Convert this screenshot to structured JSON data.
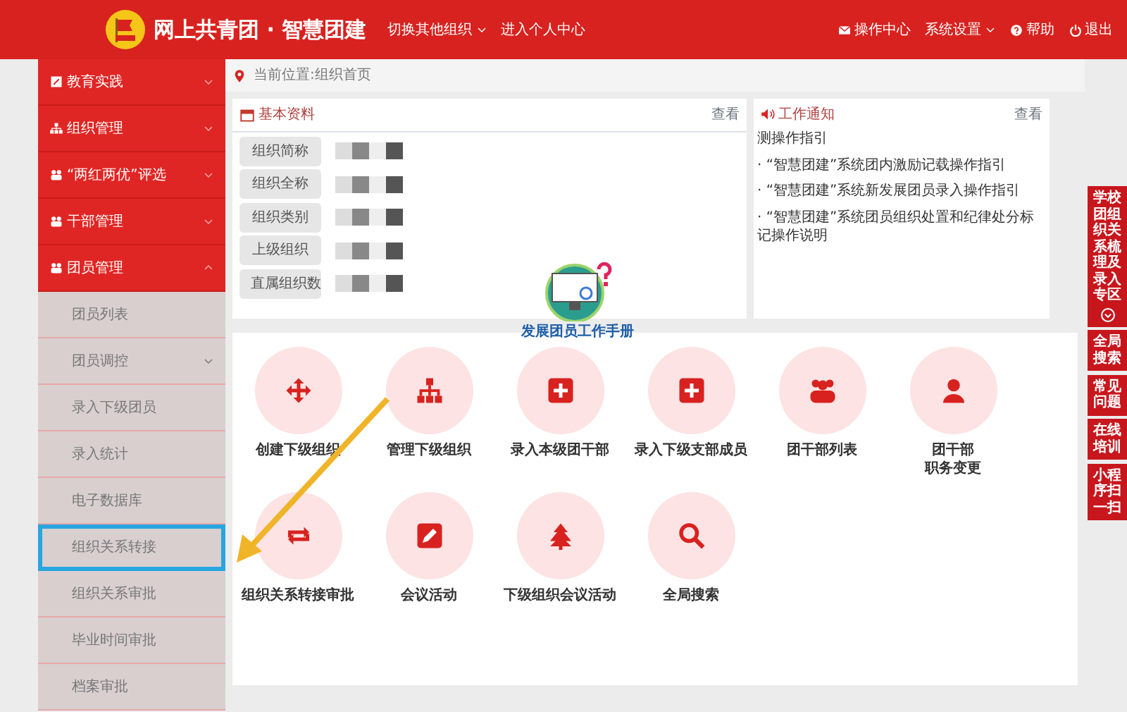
{
  "header": {
    "title": "网上共青团 · 智慧团建",
    "nav": [
      {
        "label": "切换其他组织",
        "dropdown": true
      },
      {
        "label": "进入个人中心",
        "dropdown": false
      }
    ],
    "actions": [
      {
        "label": "操作中心",
        "dropdown": false
      },
      {
        "label": "系统设置",
        "dropdown": true
      },
      {
        "label": "帮助",
        "dropdown": false
      },
      {
        "label": "退出",
        "dropdown": false
      }
    ]
  },
  "sidebar": {
    "items": [
      {
        "label": "教育实践",
        "expanded": false
      },
      {
        "label": "组织管理",
        "expanded": false
      },
      {
        "label": "“两红两优”评选",
        "expanded": false
      },
      {
        "label": "干部管理",
        "expanded": false
      },
      {
        "label": "团员管理",
        "expanded": true,
        "children": [
          {
            "label": "团员列表",
            "has_submenu": false,
            "highlighted": false
          },
          {
            "label": "团员调控",
            "has_submenu": true,
            "highlighted": false
          },
          {
            "label": "录入下级团员",
            "has_submenu": false,
            "highlighted": false
          },
          {
            "label": "录入统计",
            "has_submenu": false,
            "highlighted": false
          },
          {
            "label": "电子数据库",
            "has_submenu": false,
            "highlighted": false
          },
          {
            "label": "组织关系转接",
            "has_submenu": false,
            "highlighted": true
          },
          {
            "label": "组织关系审批",
            "has_submenu": false,
            "highlighted": false
          },
          {
            "label": "毕业时间审批",
            "has_submenu": false,
            "highlighted": false
          },
          {
            "label": "档案审批",
            "has_submenu": false,
            "highlighted": false
          }
        ]
      }
    ]
  },
  "breadcrumb": "当前位置:组织首页",
  "basic_info": {
    "title": "基本资料",
    "link": "查看",
    "fields": [
      {
        "label": "组织简称"
      },
      {
        "label": "组织全称"
      },
      {
        "label": "组织类别"
      },
      {
        "label": "上级组织"
      },
      {
        "label": "直属组织数"
      }
    ]
  },
  "notices": {
    "title": "工作通知",
    "link": "查看",
    "items": [
      {
        "text": "测操作指引"
      },
      {
        "text": "· “智慧团建”系统团内激励记载操作指引"
      },
      {
        "text": "· “智慧团建”系统新发展团员录入操作指引"
      },
      {
        "text": "· “智慧团建”系统团员组织处置和纪律处分标记操作说明"
      }
    ]
  },
  "functions": [
    {
      "label": "创建下级组织"
    },
    {
      "label": "管理下级组织"
    },
    {
      "label": "录入本级团干部"
    },
    {
      "label": "录入下级支部成员"
    },
    {
      "label": "团干部列表"
    },
    {
      "lines": [
        "团干部",
        "职务变更"
      ]
    },
    {
      "label": "组织关系转接审批"
    },
    {
      "label": "会议活动"
    },
    {
      "label": "下级组织会议活动"
    },
    {
      "label": "全局搜索"
    }
  ],
  "sticker": {
    "label": "发展团员工作手册"
  },
  "side_tabs": [
    {
      "label": "学校团组织关系梳理及录入专区",
      "icon": true
    },
    {
      "label": "全局搜索",
      "icon": false
    },
    {
      "label": "常见问题",
      "icon": false
    },
    {
      "label": "在线培训",
      "icon": false
    },
    {
      "label": "小程序扫一扫",
      "icon": false
    }
  ]
}
